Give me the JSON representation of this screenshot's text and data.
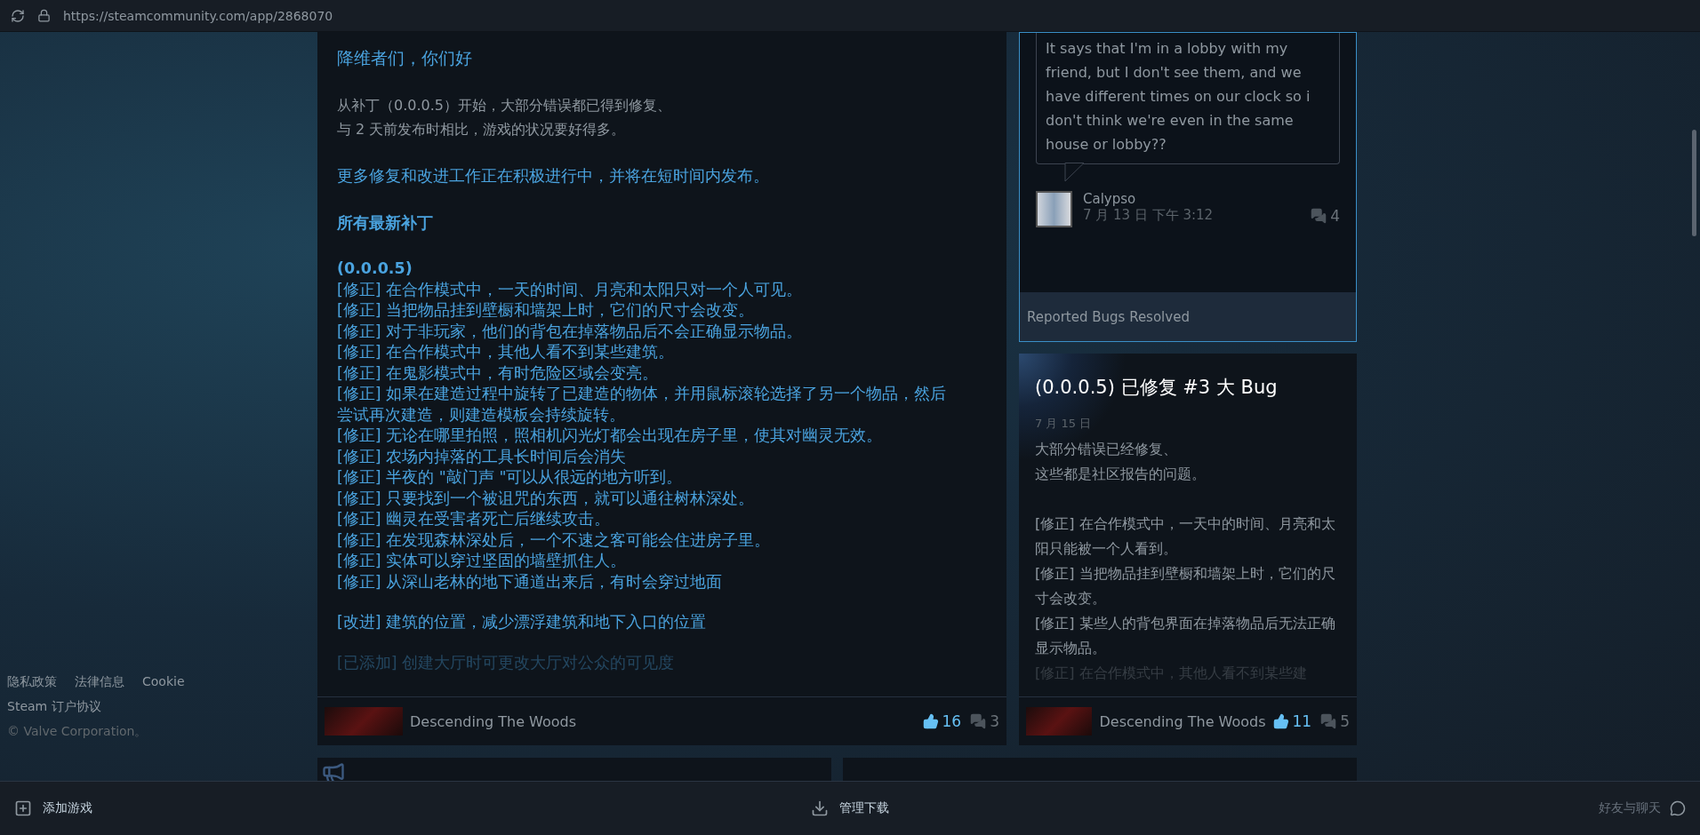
{
  "address_bar": {
    "url": "https://steamcommunity.com/app/2868070"
  },
  "footer": {
    "links": [
      "隐私政策",
      "法律信息",
      "Cookie",
      "Steam 订户协议"
    ],
    "copyright": "© Valve Corporation。"
  },
  "announcement": {
    "blocks": [
      {
        "kind": "greeting",
        "lines": [
          "降维者们，你们好"
        ]
      },
      {
        "kind": "intro",
        "lines": [
          "从补丁（0.0.0.5）开始，大部分错误都已得到修复、",
          "与 2 天前发布时相比，游戏的状况要好得多。"
        ]
      },
      {
        "kind": "note",
        "lines": [
          "更多修复和改进工作正在积极进行中，并将在短时间内发布。"
        ]
      },
      {
        "kind": "section",
        "lines": [
          "所有最新补丁"
        ]
      },
      {
        "kind": "changelog",
        "title": "(0.0.0.5)",
        "lines": [
          "[修正] 在合作模式中，一天的时间、月亮和太阳只对一个人可见。",
          "[修正] 当把物品挂到壁橱和墙架上时，它们的尺寸会改变。",
          "[修正] 对于非玩家，他们的背包在掉落物品后不会正确显示物品。",
          "[修正] 在合作模式中，其他人看不到某些建筑。",
          "[修正] 在鬼影模式中，有时危险区域会变亮。",
          "[修正] 如果在建造过程中旋转了已建造的物体，并用鼠标滚轮选择了另一个物品，然后尝试再次建造，则建造模板会持续旋转。",
          "[修正] 无论在哪里拍照，照相机闪光灯都会出现在房子里，使其对幽灵无效。",
          "[修正] 农场内掉落的工具长时间后会消失",
          "[修正] 半夜的 \"敲门声 \"可以从很远的地方听到。",
          "[修正] 只要找到一个被诅咒的东西，就可以通往树林深处。",
          "[修正] 幽灵在受害者死亡后继续攻击。",
          "[修正] 在发现森林深处后，一个不速之客可能会住进房子里。",
          "[修正] 实体可以穿过坚固的墙壁抓住人。",
          "[修正] 从深山老林的地下通道出来后，有时会穿过地面"
        ]
      },
      {
        "kind": "changelog",
        "lines": [
          "[改进] 建筑的位置，减少漂浮建筑和地下入口的位置"
        ]
      }
    ],
    "faded_line": "[已添加] 创建大厅时可更改大厅对公众的可见度",
    "game": "Descending The Woods",
    "likes": "16",
    "comments": "3"
  },
  "discussion": {
    "text": "It says that I'm in a lobby with my friend, but I don't see them, and we have different times on our clock so i don't think we're even in the same house or lobby??",
    "author": "Calypso",
    "time": "7 月 13 日 下午 3:12",
    "comments": "4",
    "caption": "Reported Bugs Resolved"
  },
  "patch_card": {
    "title": "(0.0.0.5) 已修复 #3 大 Bug",
    "date": "7 月 15 日",
    "paragraphs": [
      [
        "大部分错误已经修复、",
        "这些都是社区报告的问题。"
      ],
      [
        "[修正] 在合作模式中，一天中的时间、月亮和太阳只能被一个人看到。",
        "[修正] 当把物品挂到壁橱和墙架上时，它们的尺寸会改变。",
        "[修正] 某些人的背包界面在掉落物品后无法正确显示物品。"
      ]
    ],
    "faded_line": "[修正] 在合作模式中，其他人看不到某些建",
    "game": "Descending The Woods",
    "likes": "11",
    "comments": "5"
  },
  "bottom_bar": {
    "add_game": "添加游戏",
    "downloads": "管理下载",
    "friends": "好友与聊天"
  }
}
